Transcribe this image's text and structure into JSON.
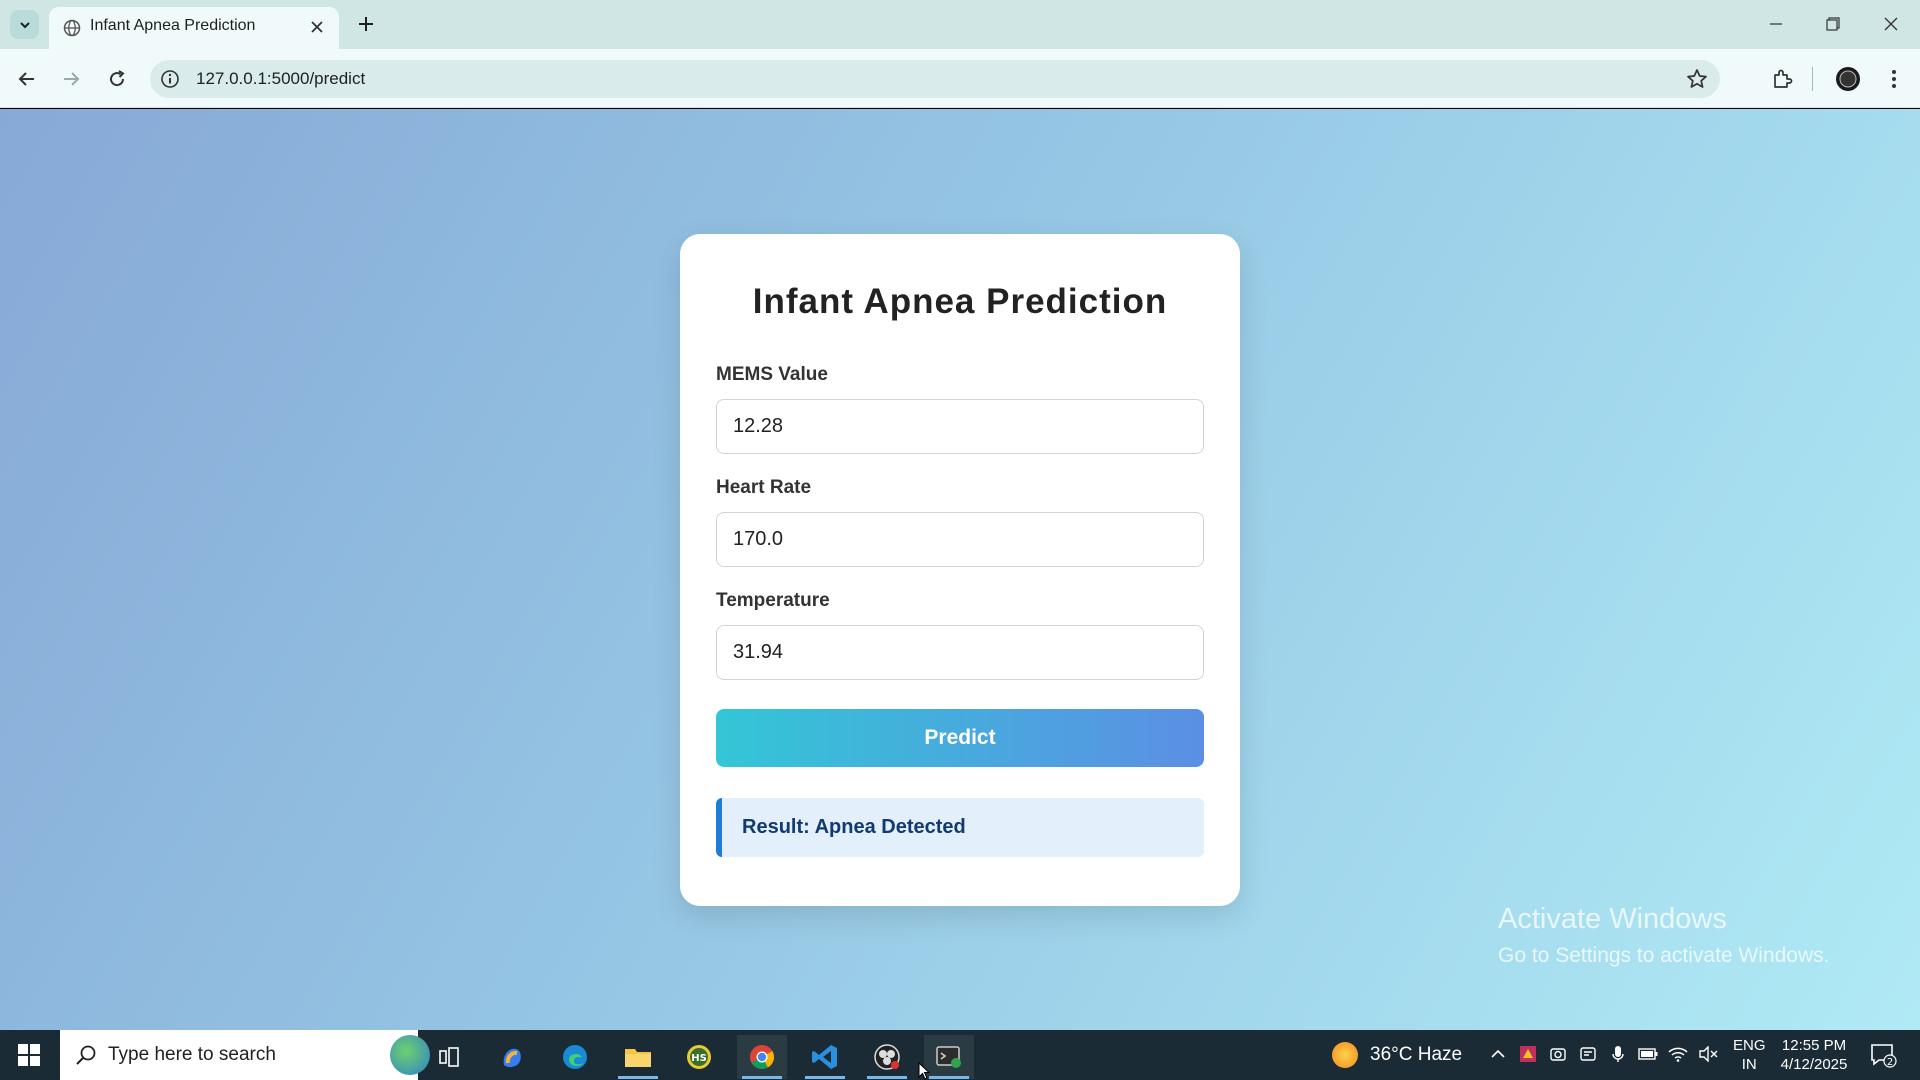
{
  "browser": {
    "tab_title": "Infant Apnea Prediction",
    "url": "127.0.0.1:5000/predict",
    "icons": [
      "tab-search-chevron-icon",
      "globe-icon",
      "close-icon",
      "plus-icon",
      "minimize-icon",
      "restore-icon",
      "window-close-icon",
      "back-arrow-icon",
      "forward-arrow-icon",
      "reload-icon",
      "info-icon",
      "star-icon",
      "extensions-icon",
      "profile-icon",
      "kebab-menu-icon"
    ]
  },
  "form": {
    "title": "Infant Apnea Prediction",
    "fields": [
      {
        "label": "MEMS Value",
        "value": "12.28"
      },
      {
        "label": "Heart Rate",
        "value": "170.0"
      },
      {
        "label": "Temperature",
        "value": "31.94"
      }
    ],
    "submit_label": "Predict",
    "result_text": "Result: Apnea Detected",
    "colors": {
      "button_start": "#33c6d6",
      "button_end": "#5b8fe4",
      "result_accent": "#1e7bd6",
      "result_text": "#123a72"
    }
  },
  "watermark": {
    "title": "Activate Windows",
    "subtitle": "Go to Settings to activate Windows."
  },
  "taskbar": {
    "search_placeholder": "Type here to search",
    "weather": "36°C  Haze",
    "language_line1": "ENG",
    "language_line2": "IN",
    "time": "12:55 PM",
    "date": "4/12/2025",
    "notification_count": "2",
    "apps": [
      "task-view-icon",
      "copilot-icon",
      "edge-icon",
      "file-explorer-icon",
      "hs-app-icon",
      "chrome-icon",
      "vscode-icon",
      "obs-icon",
      "terminal-icon"
    ]
  }
}
